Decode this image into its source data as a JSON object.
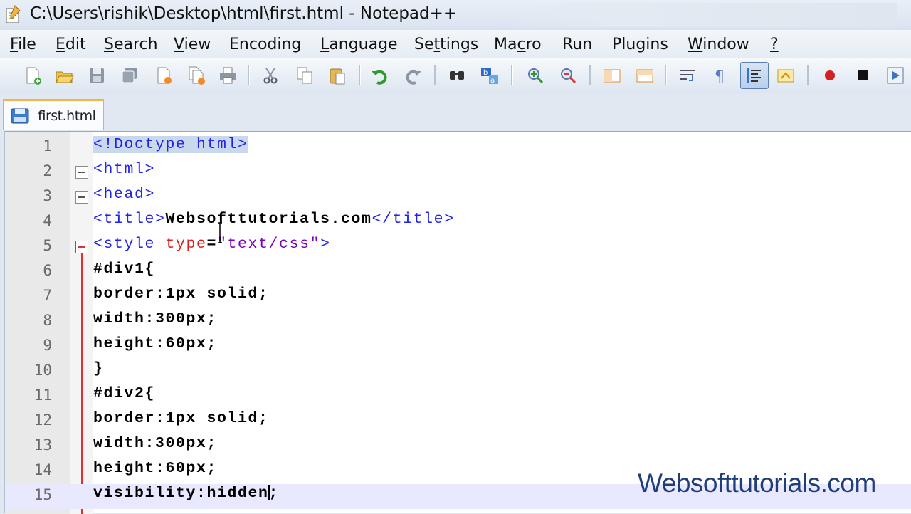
{
  "window": {
    "title": "C:\\Users\\rishik\\Desktop\\html\\first.html - Notepad++"
  },
  "menu": {
    "items": [
      {
        "label": "File",
        "u": "F"
      },
      {
        "label": "Edit",
        "u": "E"
      },
      {
        "label": "Search",
        "u": "S"
      },
      {
        "label": "View",
        "u": "V"
      },
      {
        "label": "Encoding",
        "u": ""
      },
      {
        "label": "Language",
        "u": "L"
      },
      {
        "label": "Settings",
        "u": "t"
      },
      {
        "label": "Macro",
        "u": "c"
      },
      {
        "label": "Run",
        "u": ""
      },
      {
        "label": "Plugins",
        "u": ""
      },
      {
        "label": "Window",
        "u": "W"
      },
      {
        "label": "?",
        "u": "?"
      }
    ]
  },
  "toolbar": {
    "icons": [
      "new-file-icon",
      "open-file-icon",
      "save-icon",
      "save-all-icon",
      "close-icon",
      "close-all-icon",
      "print-icon",
      "cut-icon",
      "copy-icon",
      "paste-icon",
      "undo-icon",
      "redo-icon",
      "find-icon",
      "replace-icon",
      "zoom-in-icon",
      "zoom-out-icon",
      "sync-vertical-icon",
      "sync-horizontal-icon",
      "word-wrap-icon",
      "show-all-characters-icon",
      "indent-guide-icon",
      "user-defined-language-icon",
      "record-macro-icon",
      "stop-recording-icon",
      "playback-macro-icon"
    ]
  },
  "tabs": [
    {
      "label": "first.html"
    }
  ],
  "editor": {
    "lines": [
      {
        "n": "1"
      },
      {
        "n": "2"
      },
      {
        "n": "3"
      },
      {
        "n": "4"
      },
      {
        "n": "5"
      },
      {
        "n": "6"
      },
      {
        "n": "7"
      },
      {
        "n": "8"
      },
      {
        "n": "9"
      },
      {
        "n": "10"
      },
      {
        "n": "11"
      },
      {
        "n": "12"
      },
      {
        "n": "13"
      },
      {
        "n": "14"
      },
      {
        "n": "15"
      }
    ],
    "code": {
      "l1": "<!Doctype html>",
      "l2": "<html>",
      "l3": "<head>",
      "l4_open": "<title>",
      "l4_text": "Websofttutorials.com",
      "l4_close": "</title>",
      "l5_tag": "<style ",
      "l5_attr": "type",
      "l5_eq": "=",
      "l5_str": "\"text/css\"",
      "l5_end": ">",
      "l6": "#div1{",
      "l7": "border:1px solid;",
      "l8": "width:300px;",
      "l9": "height:60px;",
      "l10": "}",
      "l11": "#div2{",
      "l12": "border:1px solid;",
      "l13": "width:300px;",
      "l14": "height:60px;",
      "l15_a": "visibility:hidden",
      "l15_b": ";"
    },
    "colors": {
      "tag": "#2222ee",
      "attribute": "#e21b1b",
      "string": "#8000c0",
      "fold_marker": "#e03030"
    }
  },
  "watermark": "Websofttutorials.com"
}
